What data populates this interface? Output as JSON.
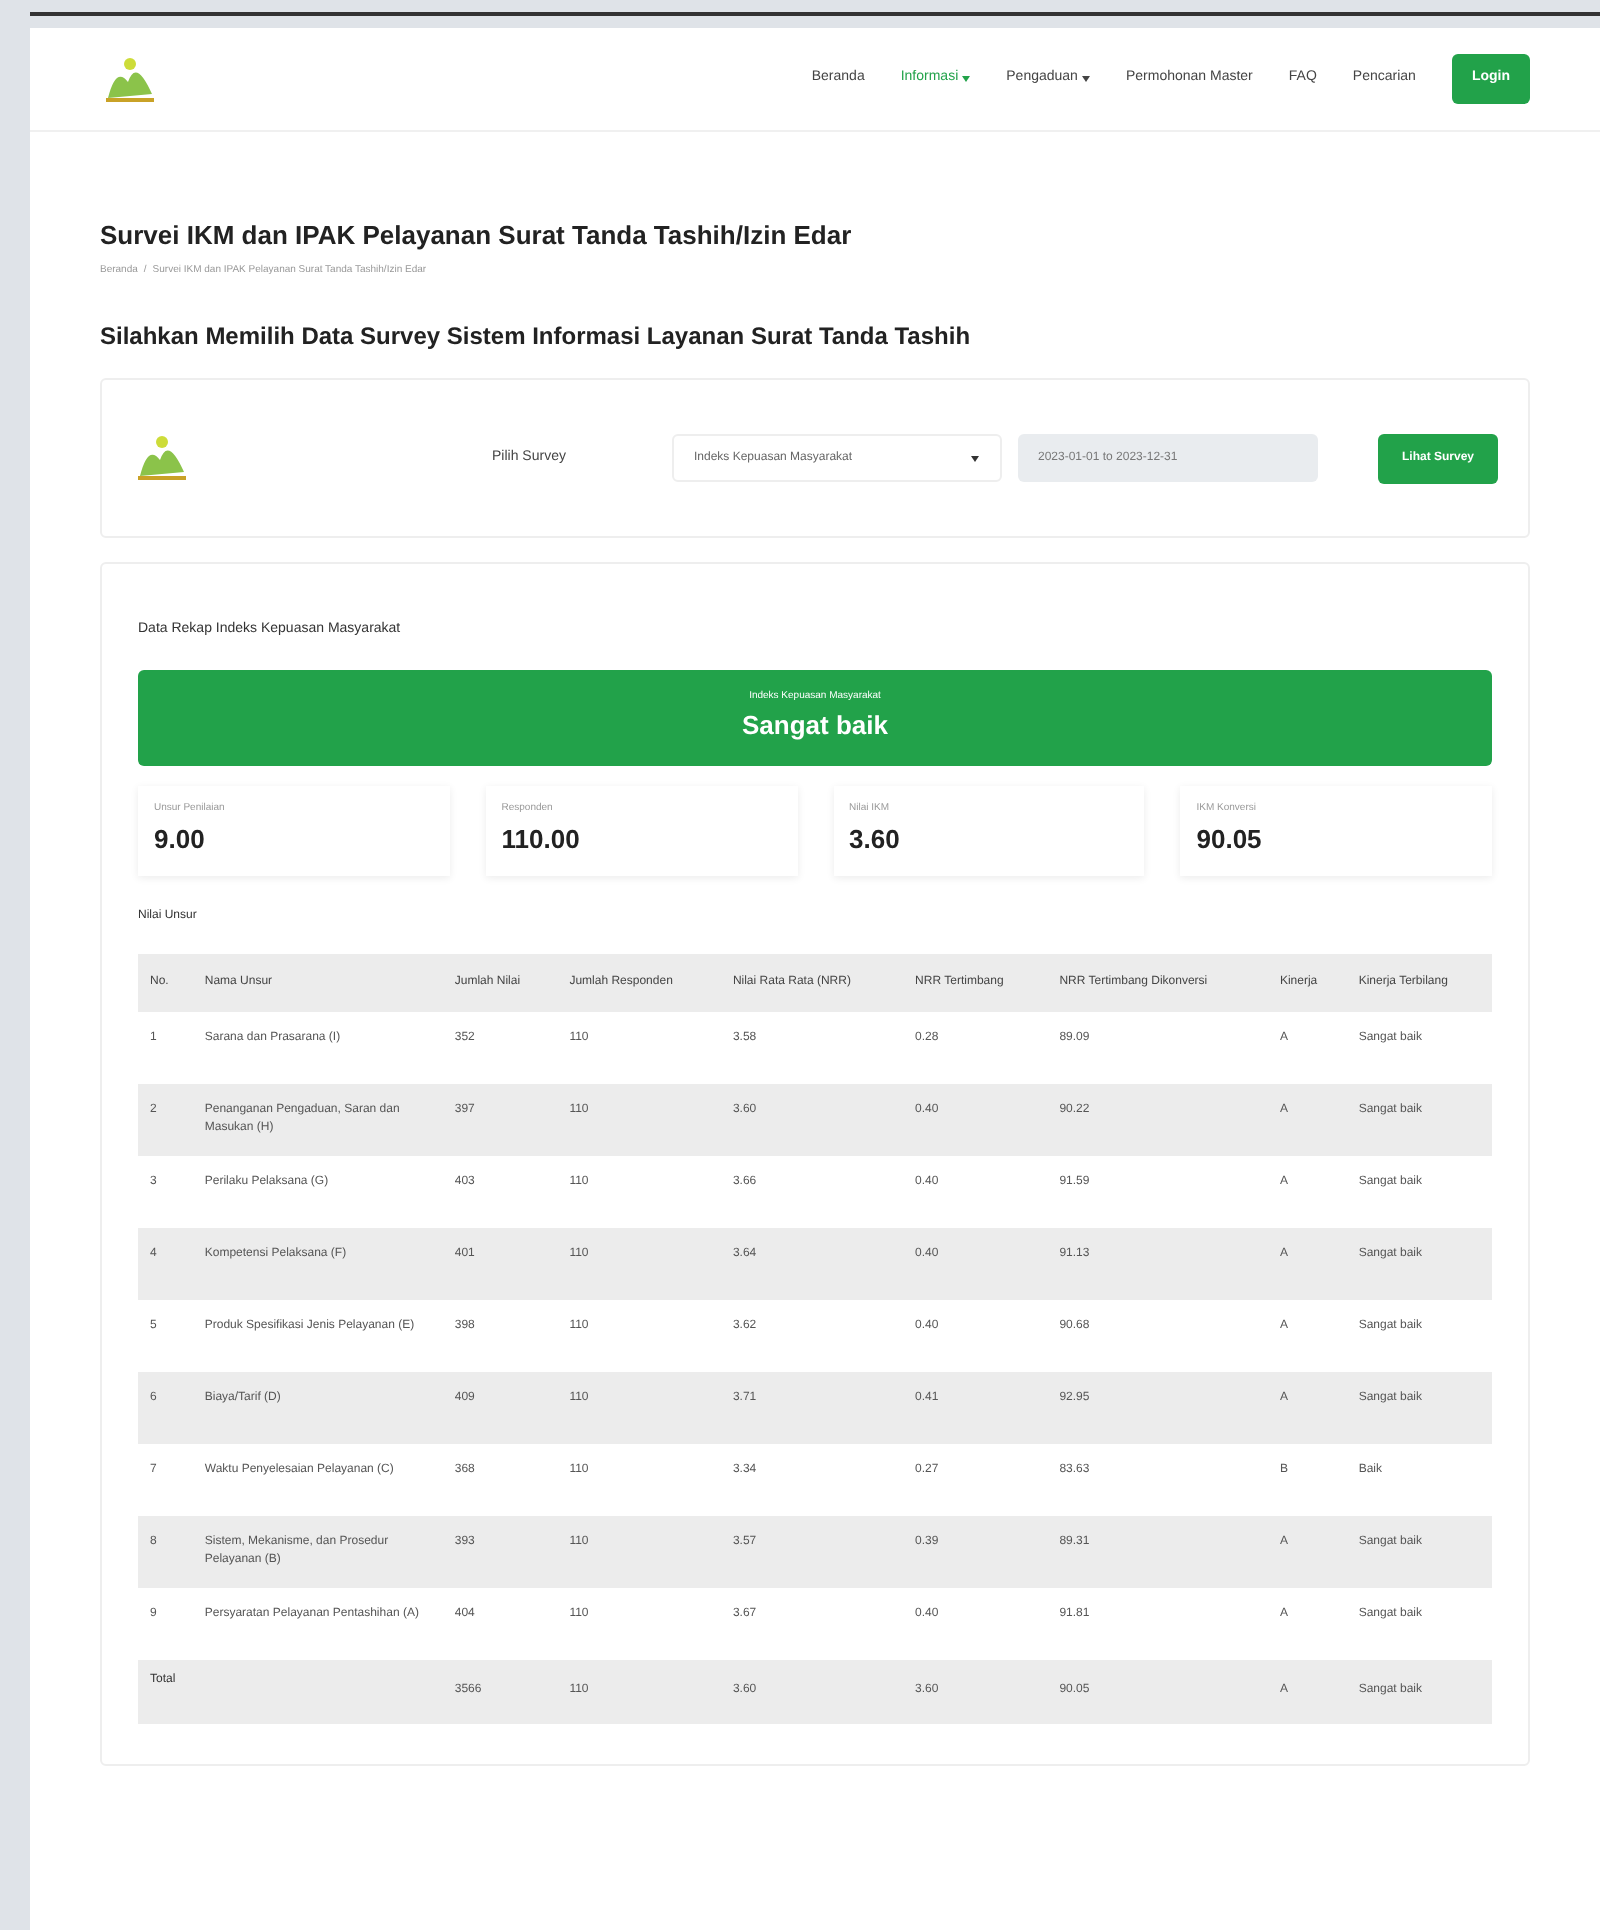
{
  "nav": {
    "items": [
      {
        "label": "Beranda",
        "selected": false,
        "dropdown": false
      },
      {
        "label": "Informasi",
        "selected": true,
        "dropdown": true
      },
      {
        "label": "Pengaduan",
        "selected": false,
        "dropdown": true
      },
      {
        "label": "Permohonan Master",
        "selected": false,
        "dropdown": false
      },
      {
        "label": "FAQ",
        "selected": false,
        "dropdown": false
      },
      {
        "label": "Pencarian",
        "selected": false,
        "dropdown": false
      }
    ],
    "login": "Login"
  },
  "page": {
    "title": "Survei IKM dan IPAK Pelayanan Surat Tanda Tashih/Izin Edar",
    "breadcrumb_separator": "/",
    "breadcrumb": [
      "Beranda",
      "Survei IKM dan IPAK Pelayanan Surat Tanda Tashih/Izin Edar"
    ]
  },
  "subtitle": "Silahkan Memilih Data Survey Sistem Informasi Layanan Surat Tanda Tashih",
  "filter": {
    "label": "Pilih Survey",
    "select": "Indeks Kepuasan Masyarakat",
    "date": "2023-01-01 to 2023-12-31",
    "button": "Lihat Survey"
  },
  "recap": {
    "title": "Data Rekap Indeks Kepuasan Masyarakat",
    "banner": {
      "label": "Indeks Kepuasan Masyarakat",
      "value": "Sangat baik"
    },
    "stats": [
      {
        "label": "Unsur Penilaian",
        "value": "9.00"
      },
      {
        "label": "Responden",
        "value": "110.00"
      },
      {
        "label": "Nilai IKM",
        "value": "3.60"
      },
      {
        "label": "IKM Konversi",
        "value": "90.05"
      }
    ],
    "table_title": "Nilai Unsur",
    "table": {
      "columns": [
        "No.",
        "Nama Unsur",
        "Jumlah Nilai",
        "Jumlah Responden",
        "Nilai Rata Rata (NRR)",
        "NRR Tertimbang",
        "NRR Tertimbang Dikonversi",
        "Kinerja",
        "Kinerja Terbilang"
      ],
      "rows": [
        [
          "1",
          "Sarana dan Prasarana (I)",
          "352",
          "110",
          "3.58",
          "0.28",
          "89.09",
          "A",
          "Sangat baik"
        ],
        [
          "2",
          "Penanganan Pengaduan, Saran dan Masukan (H)",
          "397",
          "110",
          "3.60",
          "0.40",
          "90.22",
          "A",
          "Sangat baik"
        ],
        [
          "3",
          "Perilaku Pelaksana (G)",
          "403",
          "110",
          "3.66",
          "0.40",
          "91.59",
          "A",
          "Sangat baik"
        ],
        [
          "4",
          "Kompetensi Pelaksana (F)",
          "401",
          "110",
          "3.64",
          "0.40",
          "91.13",
          "A",
          "Sangat baik"
        ],
        [
          "5",
          "Produk Spesifikasi Jenis Pelayanan (E)",
          "398",
          "110",
          "3.62",
          "0.40",
          "90.68",
          "A",
          "Sangat baik"
        ],
        [
          "6",
          "Biaya/Tarif (D)",
          "409",
          "110",
          "3.71",
          "0.41",
          "92.95",
          "A",
          "Sangat baik"
        ],
        [
          "7",
          "Waktu Penyelesaian Pelayanan (C)",
          "368",
          "110",
          "3.34",
          "0.27",
          "83.63",
          "B",
          "Baik"
        ],
        [
          "8",
          "Sistem, Mekanisme, dan Prosedur Pelayanan (B)",
          "393",
          "110",
          "3.57",
          "0.39",
          "89.31",
          "A",
          "Sangat baik"
        ],
        [
          "9",
          "Persyaratan Pelayanan Pentashihan (A)",
          "404",
          "110",
          "3.67",
          "0.40",
          "91.81",
          "A",
          "Sangat baik"
        ]
      ],
      "total": [
        "Total",
        "3566",
        "110",
        "3.60",
        "3.60",
        "90.05",
        "A",
        "Sangat baik"
      ]
    }
  }
}
